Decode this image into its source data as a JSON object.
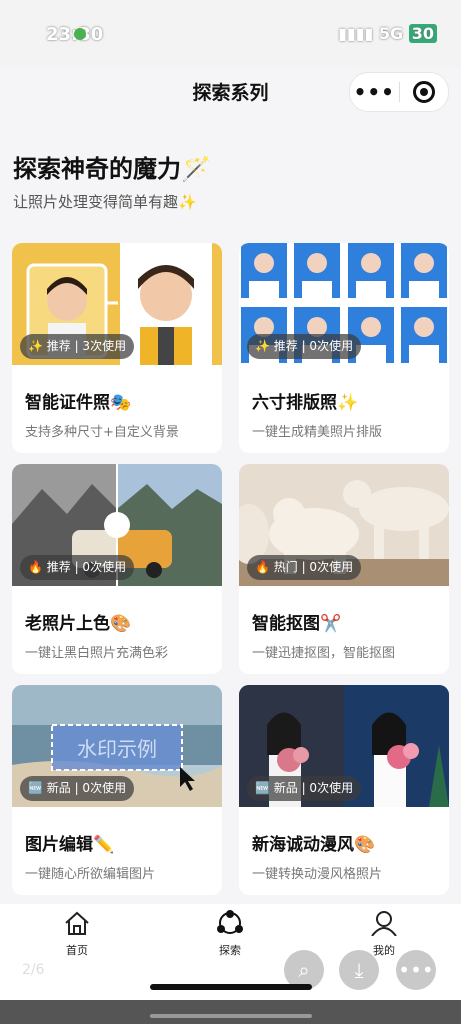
{
  "status": {
    "time": "23:30",
    "network": "5G",
    "battery": "30"
  },
  "nav": {
    "title": "探索系列",
    "more": "•••"
  },
  "hero": {
    "title": "探索神奇的魔力🪄",
    "subtitle": "让照片处理变得简单有趣✨"
  },
  "cards": [
    {
      "tag": "✨ 推荐 | 3次使用",
      "title": "智能证件照🎭",
      "desc": "支持多种尺寸+自定义背景"
    },
    {
      "tag": "✨ 推荐 | 0次使用",
      "title": "六寸排版照✨",
      "desc": "一键生成精美照片排版"
    },
    {
      "tag": "🔥 推荐 | 0次使用",
      "title": "老照片上色🎨",
      "desc": "一键让黑白照片充满色彩"
    },
    {
      "tag": "🔥 热门 | 0次使用",
      "title": "智能抠图✂️",
      "desc": "一键迅捷抠图，智能抠图"
    },
    {
      "tag": "🆕 新品 | 0次使用",
      "title": "图片编辑✏️",
      "desc": "一键随心所欲编辑图片",
      "watermark": "水印示例"
    },
    {
      "tag": "🆕 新品 | 0次使用",
      "title": "新海诚动漫风🎨",
      "desc": "一键转换动漫风格照片"
    }
  ],
  "tabbar": [
    {
      "label": "首页",
      "icon": "home-icon"
    },
    {
      "label": "探索",
      "icon": "explore-icon"
    },
    {
      "label": "我的",
      "icon": "user-icon"
    }
  ],
  "page_indicator": "2/6",
  "colors": {
    "card_bg": "#ffffff",
    "page_bg": "#f5f5f7",
    "fab": "#c9c9c9"
  }
}
